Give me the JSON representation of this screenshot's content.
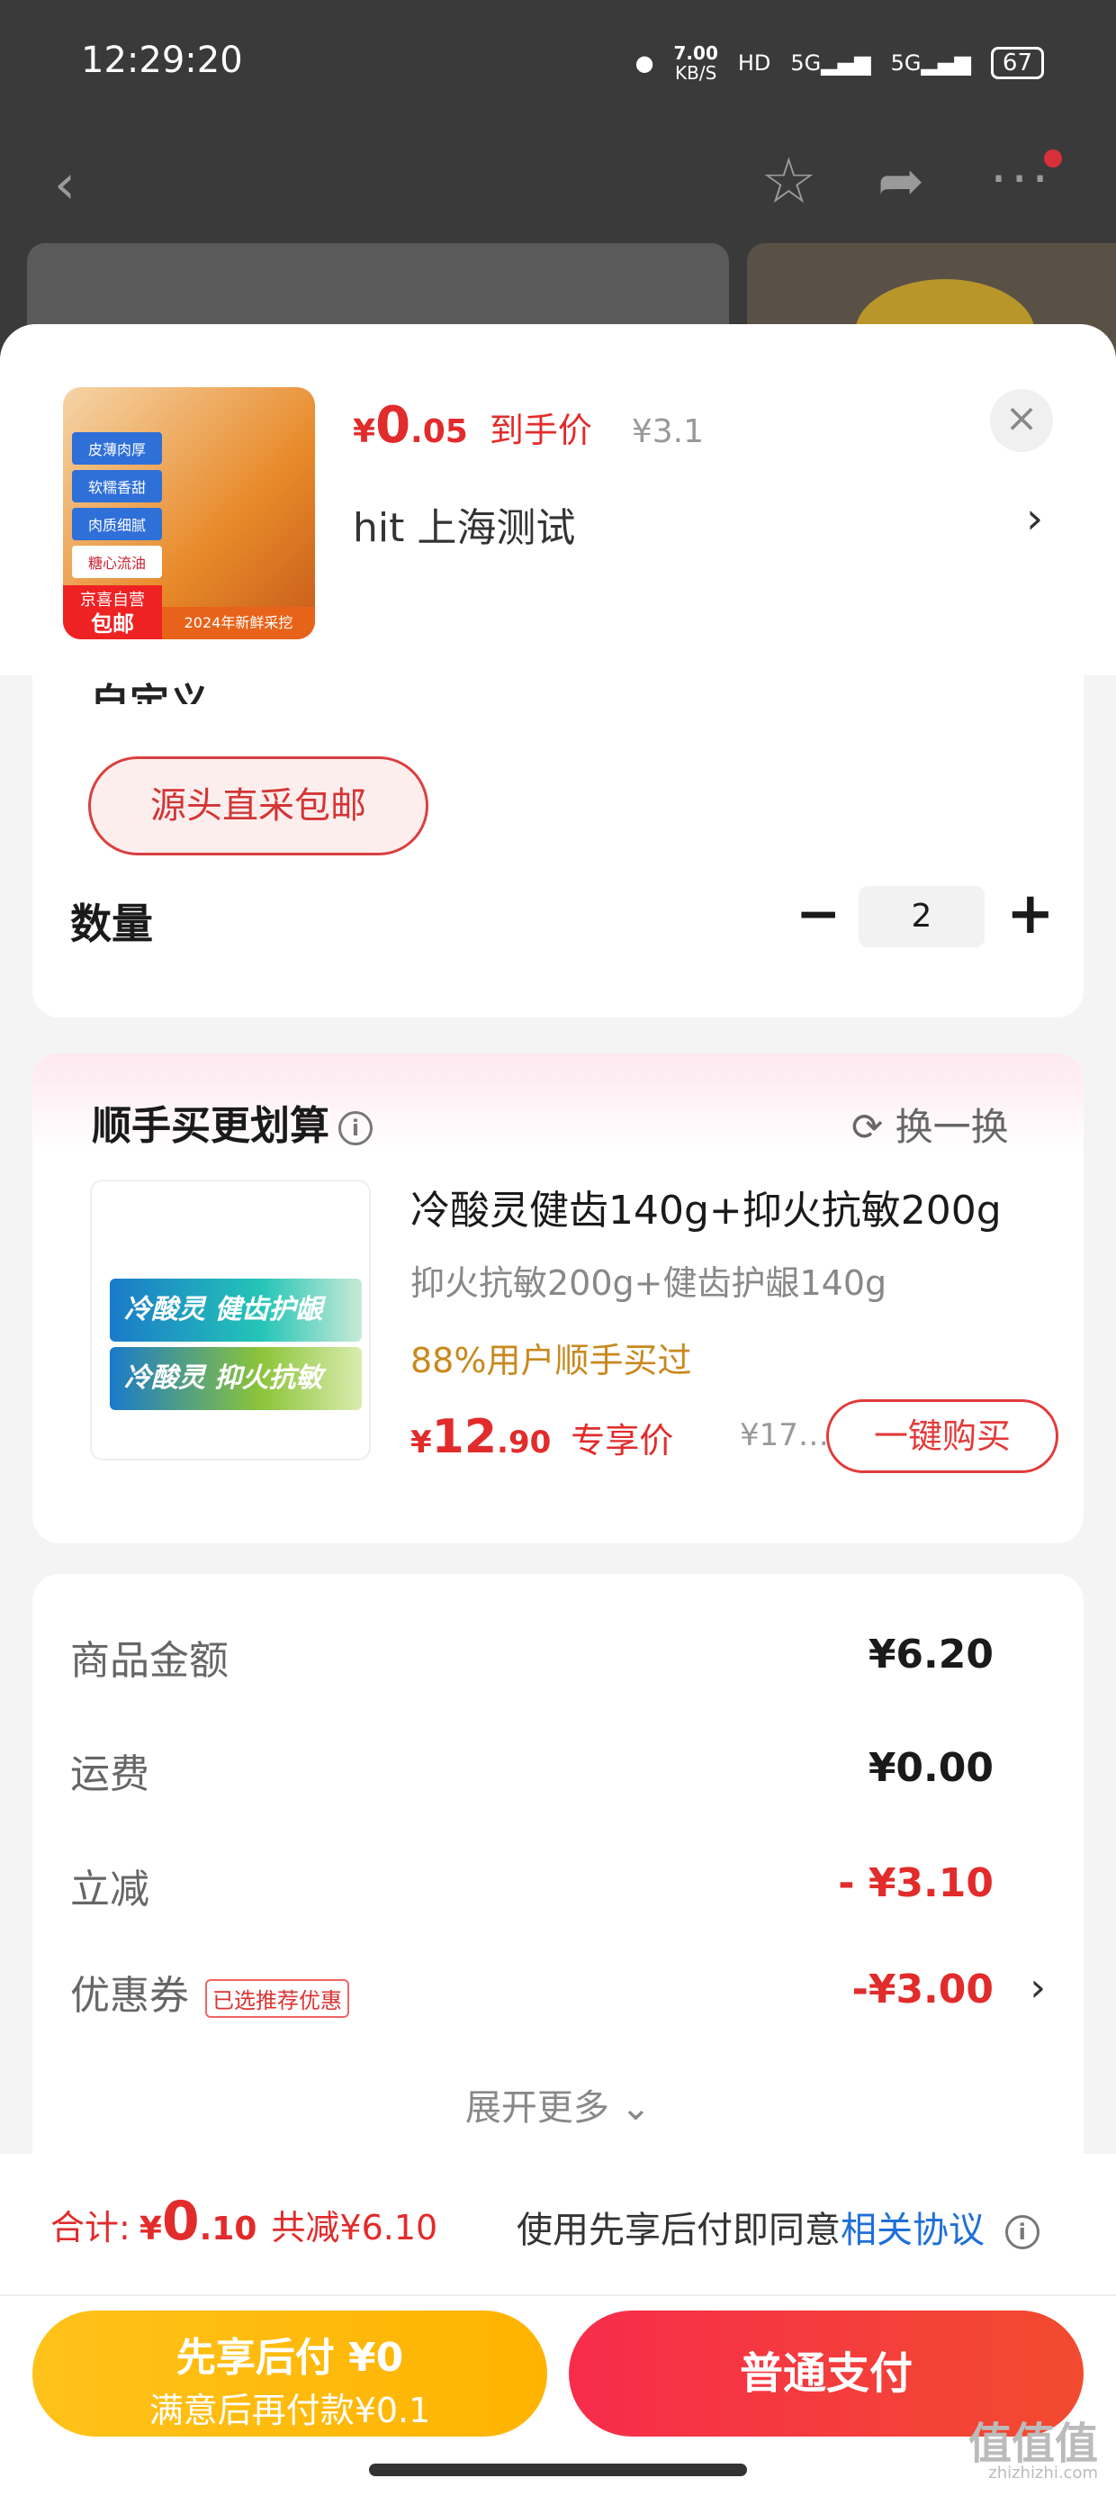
{
  "status_bar": {
    "time": "12:29:20",
    "net_speed_value": "7.00",
    "net_speed_unit": "KB/S",
    "hd": "HD",
    "net1": "5G",
    "net2": "5G",
    "battery": "67"
  },
  "product": {
    "price_currency": "¥",
    "price_int": "0",
    "price_dec": ".05",
    "price_label": "到手价",
    "orig_price": "¥3.1",
    "address": "hit  上海测试",
    "thumb_tags": [
      "皮薄肉厚",
      "软糯香甜",
      "肉质细腻",
      "糖心流油"
    ],
    "thumb_badge_small": "京喜自营",
    "thumb_badge": "包邮",
    "thumb_year": "2024年新鲜采挖"
  },
  "spec": {
    "title": "自定义",
    "option": "源头直采包邮",
    "qty_label": "数量",
    "qty": "2"
  },
  "recommend": {
    "title": "顺手买更划算",
    "swap": "换一换",
    "name": "冷酸灵健齿140g+抑火抗敏200g",
    "sub": "抑火抗敏200g+健齿护龈140g",
    "tag": "88%用户顺手买过",
    "price_currency": "¥",
    "price_int": "12",
    "price_dec": ".90",
    "price_label": "专享价",
    "orig": "¥17…",
    "buy": "一键购买",
    "pack1": "冷酸灵 健齿护龈",
    "pack2": "冷酸灵 抑火抗敏"
  },
  "summary": {
    "rows": [
      {
        "label": "商品金额",
        "value": "¥6.20"
      },
      {
        "label": "运费",
        "value": "¥0.00"
      },
      {
        "label": "立减",
        "value": "- ¥3.10"
      },
      {
        "label": "优惠券",
        "value": "-¥3.00",
        "tag": "已选推荐优惠"
      }
    ],
    "expand": "展开更多 ⌄"
  },
  "footer": {
    "total_label": "合计:",
    "total_currency": "¥",
    "total_int": "0",
    "total_dec": ".10",
    "total_cut": "共减¥6.10",
    "agree_text": "使用先享后付即同意",
    "agree_link": "相关协议",
    "pay_later_l1": "先享后付 ¥0",
    "pay_later_l2": "满意后再付款¥0.1",
    "pay_normal": "普通支付",
    "watermark": "值值值",
    "watermark_sub": "zhizhizhi.com"
  },
  "colors": {
    "accent": "#e22b2b",
    "pay_later": "#ffbb10",
    "link": "#1e6fd8"
  }
}
